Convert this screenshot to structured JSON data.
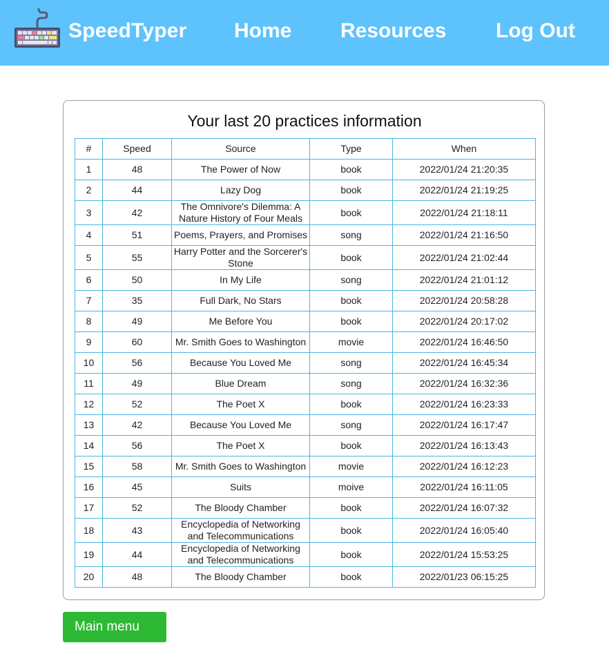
{
  "nav": {
    "brand": "SpeedTyper",
    "home": "Home",
    "resources": "Resources",
    "logout": "Log Out"
  },
  "card": {
    "title": "Your last 20 practices information"
  },
  "table": {
    "headers": [
      "#",
      "Speed",
      "Source",
      "Type",
      "When"
    ],
    "rows": [
      [
        "1",
        "48",
        "The Power of Now",
        "book",
        "2022/01/24 21:20:35"
      ],
      [
        "2",
        "44",
        "Lazy Dog",
        "book",
        "2022/01/24 21:19:25"
      ],
      [
        "3",
        "42",
        "The Omnivore's Dilemma: A Nature History of Four Meals",
        "book",
        "2022/01/24 21:18:11"
      ],
      [
        "4",
        "51",
        "Poems, Prayers, and Promises",
        "song",
        "2022/01/24 21:16:50"
      ],
      [
        "5",
        "55",
        "Harry Potter and the Sorcerer's Stone",
        "book",
        "2022/01/24 21:02:44"
      ],
      [
        "6",
        "50",
        "In My Life",
        "song",
        "2022/01/24 21:01:12"
      ],
      [
        "7",
        "35",
        "Full Dark, No Stars",
        "book",
        "2022/01/24 20:58:28"
      ],
      [
        "8",
        "49",
        "Me Before You",
        "book",
        "2022/01/24 20:17:02"
      ],
      [
        "9",
        "60",
        "Mr. Smith Goes to Washington",
        "movie",
        "2022/01/24 16:46:50"
      ],
      [
        "10",
        "56",
        "Because You Loved Me",
        "song",
        "2022/01/24 16:45:34"
      ],
      [
        "11",
        "49",
        "Blue Dream",
        "song",
        "2022/01/24 16:32:36"
      ],
      [
        "12",
        "52",
        "The Poet X",
        "book",
        "2022/01/24 16:23:33"
      ],
      [
        "13",
        "42",
        "Because You Loved Me",
        "song",
        "2022/01/24 16:17:47"
      ],
      [
        "14",
        "56",
        "The Poet X",
        "book",
        "2022/01/24 16:13:43"
      ],
      [
        "15",
        "58",
        "Mr. Smith Goes to Washington",
        "movie",
        "2022/01/24 16:12:23"
      ],
      [
        "16",
        "45",
        "Suits",
        "moive",
        "2022/01/24 16:11:05"
      ],
      [
        "17",
        "52",
        "The Bloody Chamber",
        "book",
        "2022/01/24 16:07:32"
      ],
      [
        "18",
        "43",
        "Encyclopedia of Networking and Telecommunications",
        "book",
        "2022/01/24 16:05:40"
      ],
      [
        "19",
        "44",
        "Encyclopedia of Networking and Telecommunications",
        "book",
        "2022/01/24 15:53:25"
      ],
      [
        "20",
        "48",
        "The Bloody Chamber",
        "book",
        "2022/01/23 06:15:25"
      ]
    ]
  },
  "buttons": {
    "main_menu": "Main menu"
  },
  "icons": {
    "logo": "keyboard-icon"
  },
  "colors": {
    "navbar": "#5ec3fd",
    "table_border": "#4ab4e6",
    "main_menu_button": "#2db933"
  }
}
